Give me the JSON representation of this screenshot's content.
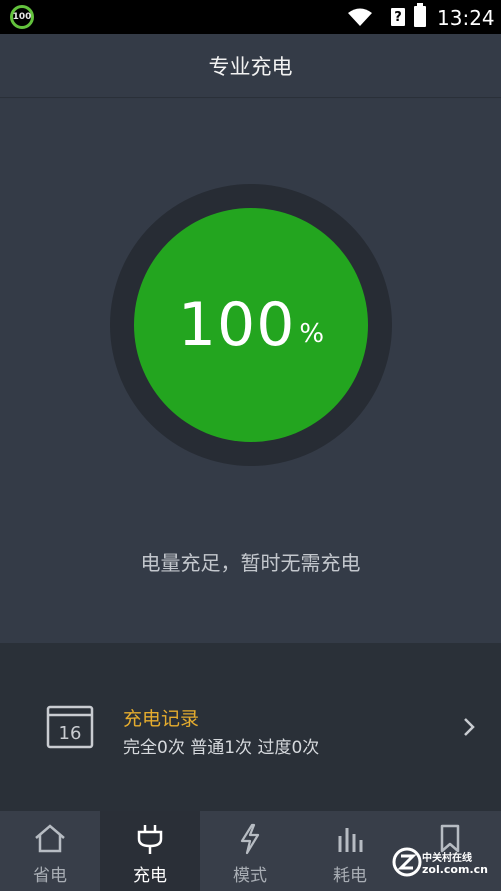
{
  "status_bar": {
    "battery_badge": "100",
    "sim_glyph": "?",
    "time": "13:24"
  },
  "header": {
    "title": "专业充电"
  },
  "gauge": {
    "level": 100,
    "value_text": "100",
    "unit": "%",
    "colors": {
      "ring": "#272c34",
      "fill": "#23a51f"
    }
  },
  "status_message": "电量充足，暂时无需充电",
  "charge_record": {
    "calendar_day": "16",
    "title": "充电记录",
    "summary": "完全0次 普通1次 过度0次"
  },
  "tabs": [
    {
      "label": "省电",
      "icon": "home-icon",
      "active": false
    },
    {
      "label": "充电",
      "icon": "plug-icon",
      "active": true
    },
    {
      "label": "模式",
      "icon": "lightning-icon",
      "active": false
    },
    {
      "label": "耗电",
      "icon": "bar-chart-icon",
      "active": false
    },
    {
      "label": "",
      "icon": "bookmark-icon",
      "active": false
    }
  ],
  "watermark": {
    "line1": "中关村在线",
    "line2": "zol.com.cn"
  }
}
